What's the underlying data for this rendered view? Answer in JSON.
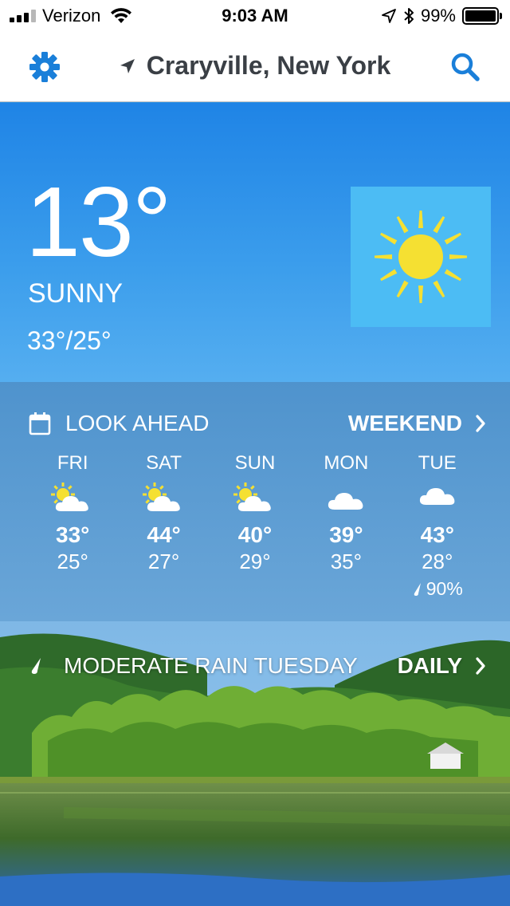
{
  "status_bar": {
    "carrier": "Verizon",
    "time": "9:03 AM",
    "battery": "99%",
    "battery_level": 0.99,
    "signal_bars": 3
  },
  "header": {
    "location": "Craryville, New York",
    "icons": [
      "gear-icon",
      "location-arrow-icon",
      "search-icon"
    ]
  },
  "current": {
    "temperature": "13°",
    "condition": "SUNNY",
    "hi_lo": "33°/25°",
    "icon": "sun-icon"
  },
  "look_ahead": {
    "title": "LOOK AHEAD",
    "link": "WEEKEND",
    "days": [
      {
        "name": "FRI",
        "icon": "partly-cloudy-icon",
        "hi": "33°",
        "lo": "25°",
        "precip": ""
      },
      {
        "name": "SAT",
        "icon": "partly-cloudy-icon",
        "hi": "44°",
        "lo": "27°",
        "precip": ""
      },
      {
        "name": "SUN",
        "icon": "partly-cloudy-icon",
        "hi": "40°",
        "lo": "29°",
        "precip": ""
      },
      {
        "name": "MON",
        "icon": "cloud-icon",
        "hi": "39°",
        "lo": "35°",
        "precip": ""
      },
      {
        "name": "TUE",
        "icon": "cloud-icon",
        "hi": "43°",
        "lo": "28°",
        "precip": "90%"
      }
    ]
  },
  "alert": {
    "text": "MODERATE RAIN TUESDAY",
    "link": "DAILY"
  },
  "colors": {
    "accent": "#1a7fd9",
    "sun": "#f5e032",
    "tile": "#4cbcf4"
  }
}
